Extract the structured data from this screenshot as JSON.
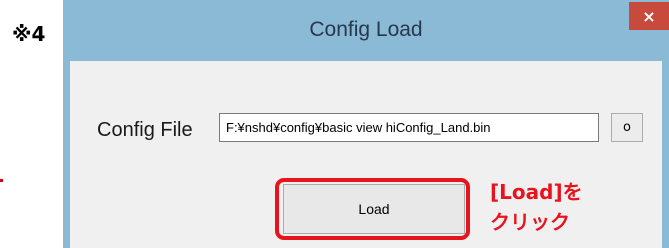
{
  "note_mark": "※4",
  "window": {
    "title": "Config Load",
    "close_glyph": "×"
  },
  "form": {
    "config_file_label": "Config File",
    "config_file_value": "F:¥nshd¥config¥basic view hiConfig_Land.bin",
    "browse_label": "o",
    "load_label": "Load"
  },
  "annotation": {
    "line1": "[Load]を",
    "line2": "クリック"
  },
  "colors": {
    "window_frame": "#8bbad7",
    "close_button": "#c84a3d",
    "highlight": "#e8141d"
  }
}
